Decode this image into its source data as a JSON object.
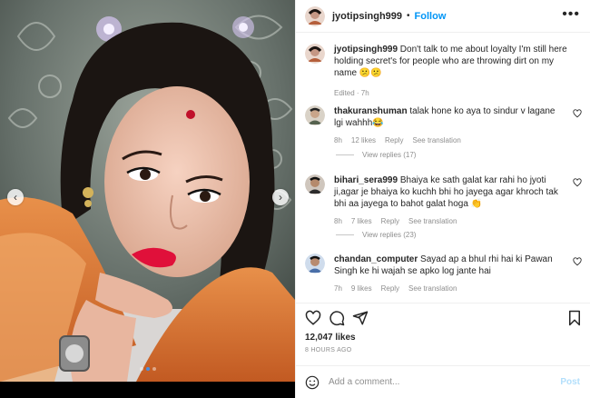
{
  "post": {
    "username": "jyotipsingh999",
    "follow_label": "Follow",
    "bullet": "•",
    "more_label": "•••",
    "media": {
      "slide_count": 3,
      "active_slide": 1,
      "prev_label": "‹",
      "next_label": "›"
    },
    "caption": {
      "username": "jyotipsingh999",
      "text": "Don't talk to me about loyalty I'm still here holding secret's for people who are throwing dirt on my name 😕😕",
      "meta": "Edited · 7h"
    },
    "comments": [
      {
        "username": "thakuranshuman",
        "text": "talak hone ko aya to sindur v lagane lgi wahhh😂",
        "time": "8h",
        "likes": "12 likes",
        "reply_label": "Reply",
        "translate_label": "See translation",
        "view_replies": "View replies (17)"
      },
      {
        "username": "bihari_sera999",
        "text": "Bhaiya ke sath galat kar rahi ho jyoti ji,agar je bhaiya ko kuchh bhi ho jayega agar khroch tak bhi aa jayega to bahot galat hoga 👏",
        "time": "8h",
        "likes": "7 likes",
        "reply_label": "Reply",
        "translate_label": "See translation",
        "view_replies": "View replies (23)"
      },
      {
        "username": "chandan_computer",
        "text": "Sayad ap a bhul rhi hai ki Pawan Singh ke hi wajah se apko log jante hai",
        "time": "7h",
        "likes": "9 likes",
        "reply_label": "Reply",
        "translate_label": "See translation"
      }
    ],
    "likes": "12,047 likes",
    "time_ago": "8 HOURS AGO",
    "add_comment": {
      "placeholder": "Add a comment...",
      "post_label": "Post"
    },
    "colors": {
      "accent": "#0095f6",
      "post_disabled": "#b2dffc",
      "secondary_text": "#8e8e8e"
    },
    "icons": [
      "heart-icon",
      "comment-icon",
      "share-icon",
      "bookmark-icon",
      "emoji-icon",
      "more-icon",
      "chevron-left-icon",
      "chevron-right-icon"
    ]
  }
}
